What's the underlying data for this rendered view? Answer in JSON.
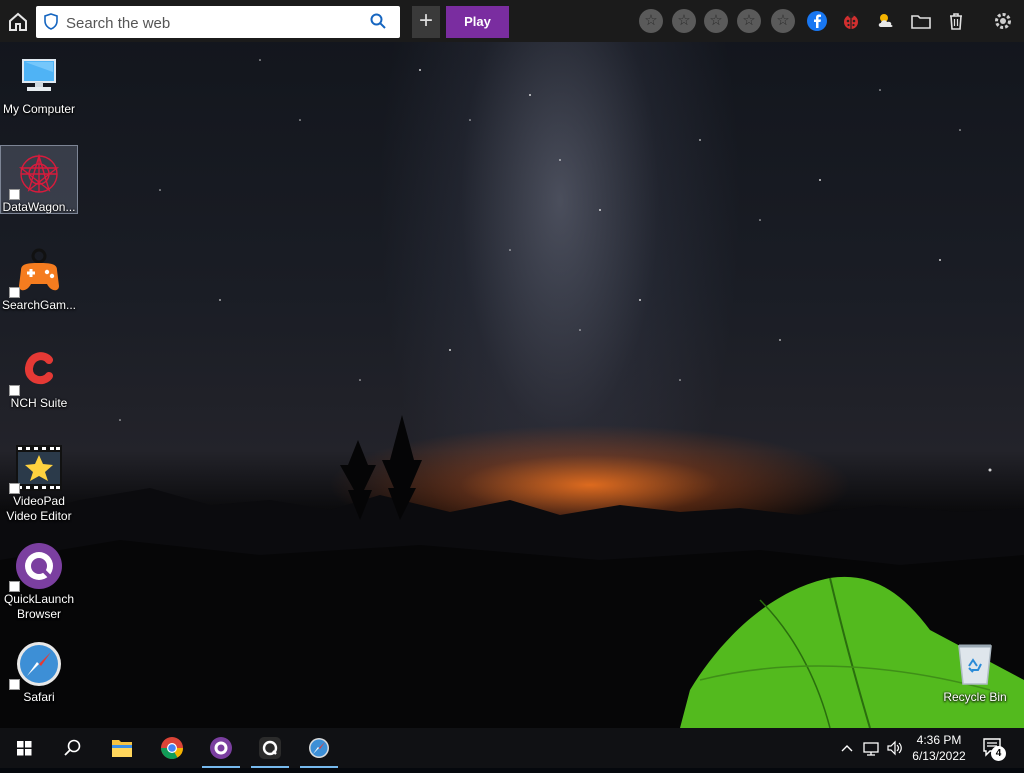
{
  "toolbar": {
    "search_placeholder": "Search the web",
    "plus_label": "+",
    "play_label": "Play",
    "star_glyph": "☆",
    "icons": [
      "home-icon",
      "shield-icon",
      "search-icon",
      "star-icon",
      "facebook-icon",
      "ladybug-icon",
      "weather-icon",
      "folder-icon",
      "trash-icon",
      "settings-icon"
    ]
  },
  "desktop": {
    "icons": [
      {
        "label": "My Computer",
        "icon": "computer-icon"
      },
      {
        "label": "DataWagon...",
        "icon": "datawagon-icon"
      },
      {
        "label": "SearchGam...",
        "icon": "gamepad-icon"
      },
      {
        "label": "NCH Suite",
        "icon": "nch-icon"
      },
      {
        "label": "VideoPad\nVideo Editor",
        "label1": "VideoPad",
        "label2": "Video Editor",
        "icon": "videopad-icon"
      },
      {
        "label": "QuickLaunch\nBrowser",
        "label1": "QuickLaunch",
        "label2": "Browser",
        "icon": "quicklaunch-icon"
      },
      {
        "label": "Safari",
        "icon": "safari-icon"
      },
      {
        "label": "Recycle Bin",
        "icon": "recycle-bin-icon"
      }
    ]
  },
  "taskbar": {
    "time": "4:36 PM",
    "date": "6/13/2022",
    "notification_count": "4",
    "apps": [
      "start-icon",
      "search-icon",
      "file-explorer-icon",
      "chrome-icon",
      "quicklaunch-icon",
      "q-browser-icon",
      "safari-icon"
    ]
  },
  "colors": {
    "play_button": "#7a2da0",
    "taskbar": "#101114",
    "toolbar": "#1b1b1b",
    "active_underline": "#76b9ed"
  }
}
